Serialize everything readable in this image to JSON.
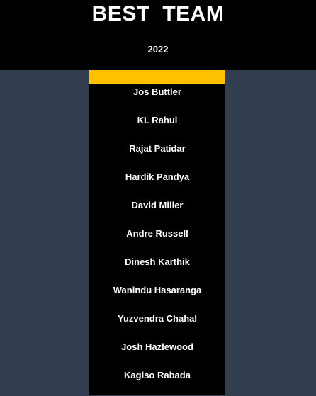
{
  "header": {
    "title": "BEST  TEAM",
    "year": "2022"
  },
  "colors": {
    "header_background": "#000000",
    "page_background": "#323e4f",
    "accent": "#ffc000",
    "text": "#ffffff"
  },
  "players": [
    "Jos Buttler",
    "KL Rahul",
    "Rajat Patidar",
    "Hardik Pandya",
    "David Miller",
    "Andre Russell",
    "Dinesh Karthik",
    "Wanindu Hasaranga",
    "Yuzvendra Chahal",
    "Josh Hazlewood",
    "Kagiso Rabada"
  ]
}
